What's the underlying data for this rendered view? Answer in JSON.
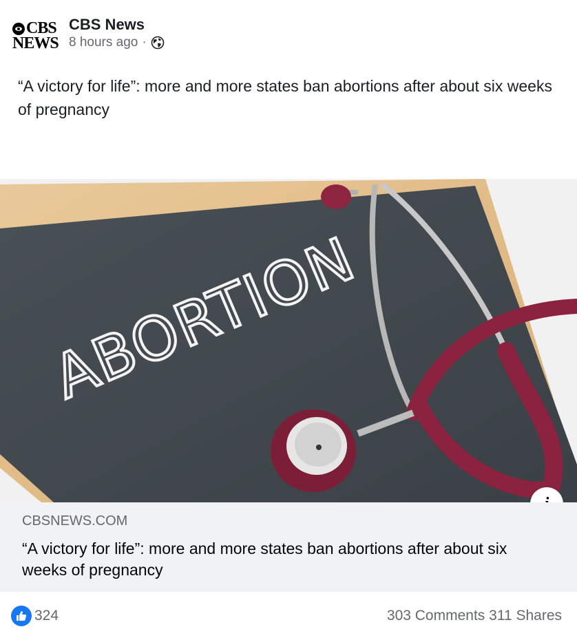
{
  "header": {
    "logo_line1": "CBS",
    "logo_line2": "NEWS",
    "page_name": "CBS News",
    "time": "8 hours ago",
    "separator": "·",
    "privacy_icon": "globe-icon"
  },
  "post": {
    "caption": "“A victory for life”: more and more states ban abortions after about six weeks of pregnancy"
  },
  "image": {
    "chalk_text": "ABORTION",
    "info_label": "i"
  },
  "link": {
    "domain": "CBSNEWS.COM",
    "title": "“A victory for life”: more and more states ban abortions after about six weeks of pregnancy"
  },
  "footer": {
    "like_count": "324",
    "comments": "303 Comments",
    "shares": "311 Shares",
    "like_icon": "thumbs-up-icon",
    "accent_color": "#1877f2"
  }
}
